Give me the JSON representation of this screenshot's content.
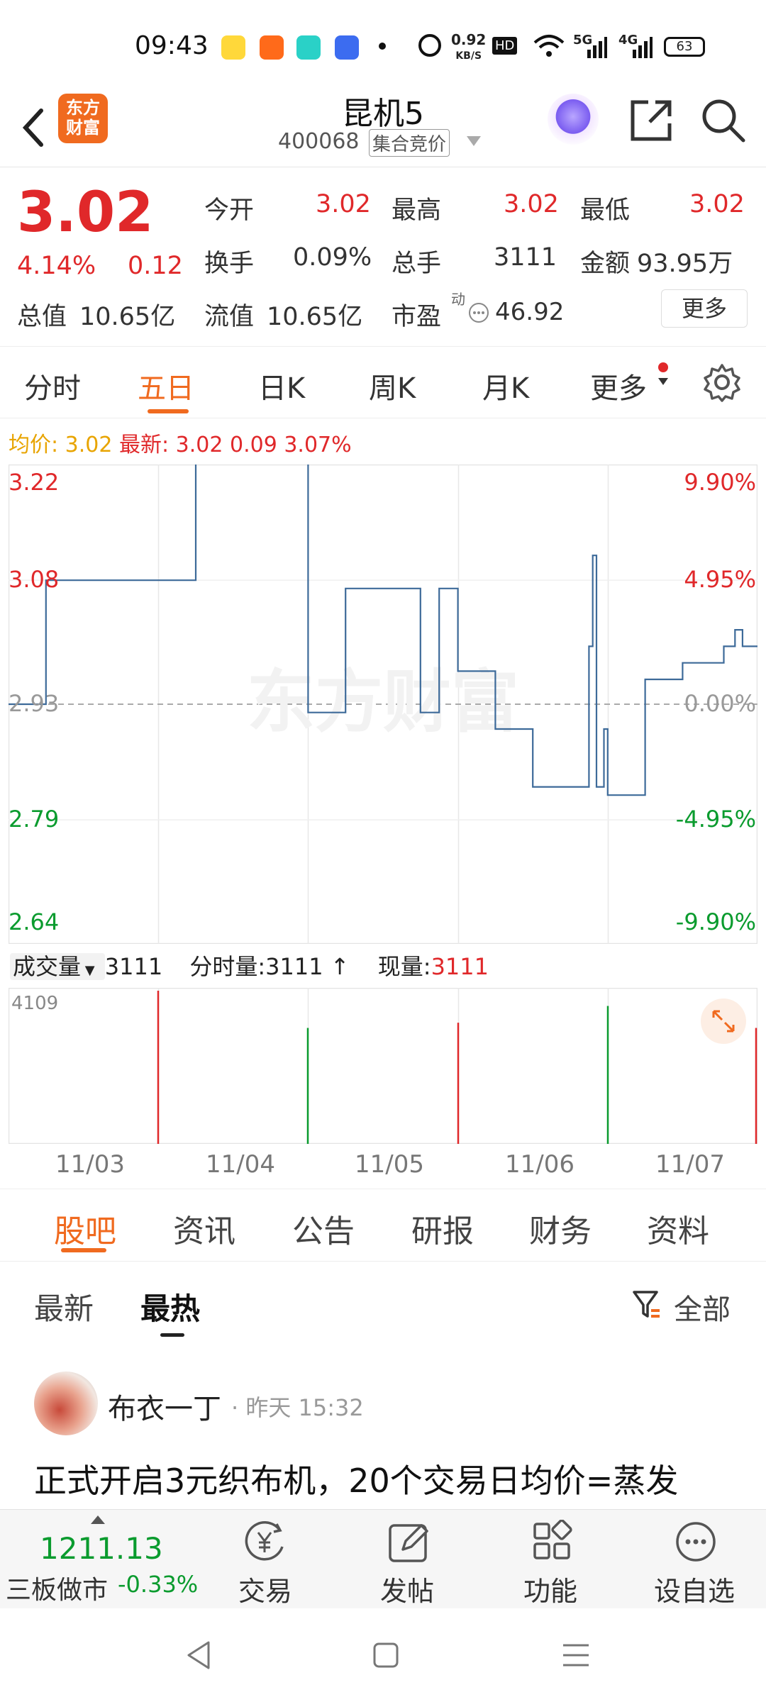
{
  "status_bar": {
    "time": "09:43",
    "speed": "0.92",
    "speed_unit": "KB/S",
    "network_5g": "5G",
    "network_4g": "4G",
    "battery": "63"
  },
  "header": {
    "logo_line1": "东方",
    "logo_line2": "财富",
    "stock_name": "昆机5",
    "stock_code": "400068",
    "auction_tag": "集合竞价"
  },
  "quote": {
    "price": "3.02",
    "change_pct": "4.14%",
    "change": "0.12",
    "open_label": "今开",
    "open": "3.02",
    "high_label": "最高",
    "high": "3.02",
    "low_label": "最低",
    "low": "3.02",
    "turnover_label": "换手",
    "turnover": "0.09%",
    "volume_label": "总手",
    "volume": "3111",
    "amount_label": "金额",
    "amount": "93.95万",
    "mktcap_label": "总值",
    "mktcap": "10.65亿",
    "float_label": "流值",
    "float": "10.65亿",
    "pe_label": "市盈",
    "pe_sup": "动",
    "pe": "46.92",
    "more": "更多"
  },
  "chart_tabs": [
    {
      "label": "分时"
    },
    {
      "label": "五日"
    },
    {
      "label": "日K"
    },
    {
      "label": "周K"
    },
    {
      "label": "月K"
    },
    {
      "label": "更多"
    }
  ],
  "chart_info": {
    "avg_label": "均价:",
    "avg": "3.02",
    "latest_label": "最新:",
    "latest": "3.02",
    "latest_change": "0.09",
    "latest_pct": "3.07%"
  },
  "volume_info": {
    "selector": "成交量",
    "total": "3111",
    "tick_label": "分时量:",
    "tick": "3111",
    "current_label": "现量:",
    "current": "3111",
    "max": "4109"
  },
  "news_tabs": [
    {
      "label": "股吧"
    },
    {
      "label": "资讯"
    },
    {
      "label": "公告"
    },
    {
      "label": "研报"
    },
    {
      "label": "财务"
    },
    {
      "label": "资料"
    }
  ],
  "feed": {
    "sort_latest": "最新",
    "sort_hot": "最热",
    "filter": "全部",
    "post": {
      "author": "布衣一丁",
      "time": "· 昨天 15:32",
      "title": "正式开启3元织布机，20个交易日均价=蒸发"
    }
  },
  "bottom_bar": {
    "index_value": "1211.13",
    "index_name": "三板做市",
    "index_change": "-0.33%",
    "trade": "交易",
    "post": "发帖",
    "functions": "功能",
    "watchlist": "设自选"
  },
  "colors": {
    "up": "#e0282a",
    "down": "#0a9b2e",
    "accent": "#f06a1f",
    "line": "#3d6a99",
    "avg": "#e8a400"
  },
  "chart_data": {
    "type": "line",
    "title": "",
    "xlabel": "",
    "ylabel": "",
    "x_tick_labels": [
      "11/03",
      "11/04",
      "11/05",
      "11/06",
      "11/07"
    ],
    "y_tick_labels_left": [
      "3.22",
      "3.08",
      "2.93",
      "2.79",
      "2.64"
    ],
    "y_tick_labels_right": [
      "9.90%",
      "4.95%",
      "0.00%",
      "-4.95%",
      "-9.90%"
    ],
    "ylim": [
      2.64,
      3.22
    ],
    "prev_close": 2.93,
    "grid": true,
    "series": [
      {
        "x": [
          0,
          0.05,
          0.05,
          0.25,
          0.25,
          0.4,
          0.4,
          0.45,
          0.45,
          0.55,
          0.55,
          0.575,
          0.575,
          0.6,
          0.6,
          0.65,
          0.65,
          0.7,
          0.7,
          0.775,
          0.775,
          0.78,
          0.78,
          0.785,
          0.785,
          0.795,
          0.795,
          0.8,
          0.8,
          0.85,
          0.85,
          0.9,
          0.9,
          0.955,
          0.955,
          0.97,
          0.97,
          0.98,
          0.98,
          1.0
        ],
        "y": [
          2.93,
          2.93,
          3.08,
          3.08,
          3.23,
          3.23,
          2.92,
          2.92,
          3.07,
          3.07,
          2.92,
          2.92,
          3.07,
          3.07,
          2.97,
          2.97,
          2.9,
          2.9,
          2.83,
          2.83,
          3.0,
          3.0,
          3.11,
          3.11,
          2.83,
          2.83,
          2.9,
          2.9,
          2.82,
          2.82,
          2.96,
          2.96,
          2.98,
          2.98,
          3.0,
          3.0,
          3.02,
          3.02,
          3.0,
          3.0
        ]
      }
    ],
    "volume": {
      "max": 4109,
      "bars": [
        {
          "day": "11/03",
          "color": "up",
          "value": 4109
        },
        {
          "day": "11/04",
          "color": "down",
          "value": 3111
        },
        {
          "day": "11/05",
          "color": "up",
          "value": 3250
        },
        {
          "day": "11/06",
          "color": "down",
          "value": 3700
        },
        {
          "day": "11/07",
          "color": "up",
          "value": 3111
        }
      ]
    }
  }
}
